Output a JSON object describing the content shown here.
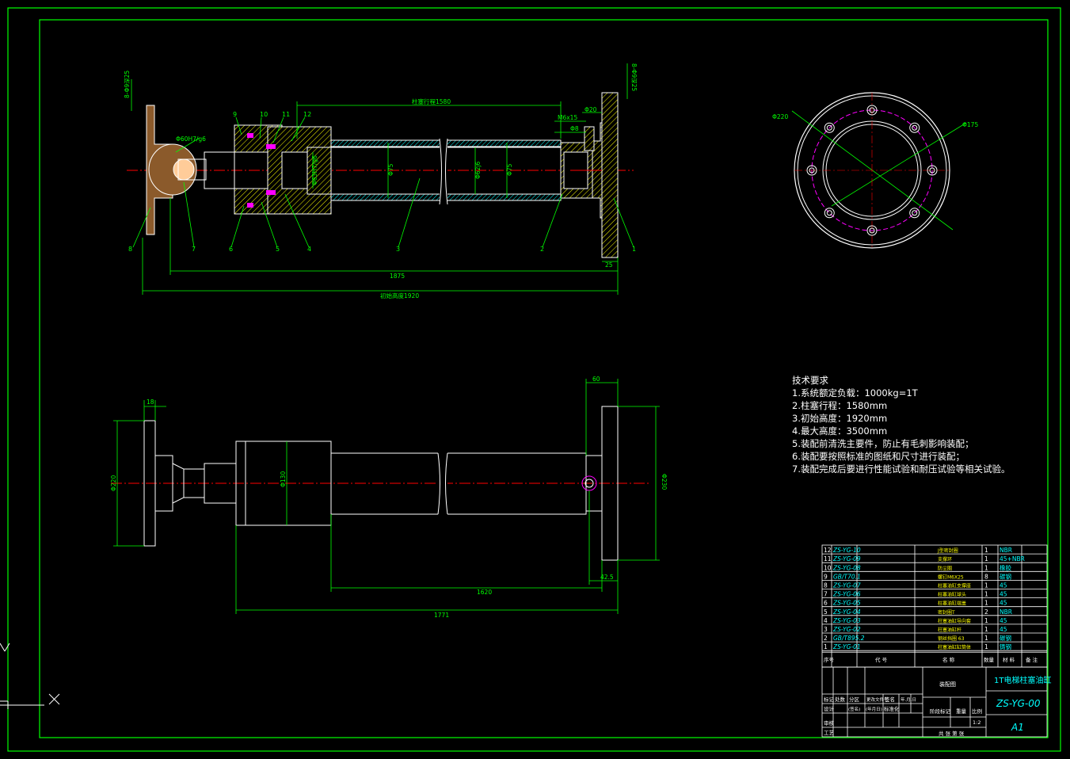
{
  "drawing": {
    "title": "1T电梯柱塞油缸",
    "drawing_number": "ZS-YG-00",
    "sheet_size": "A1",
    "scale": "1:2",
    "assembly_label": "装配图",
    "colors": {
      "background": "#000000",
      "frame": "#00ff00",
      "outline": "#ffffff",
      "centerline": "#ff0000",
      "hatch_yellow": "#ffff00",
      "dimension": "#00ff00",
      "section_cyan": "#00ffff",
      "seal": "#ff00ff",
      "flange_brown": "#8b5a2b",
      "magenta_circle": "#ff00ff"
    }
  },
  "technical_requirements": {
    "heading": "技术要求",
    "items": [
      "1.系统额定负载：1000kg=1T",
      "2.柱塞行程：1580mm",
      "3.初始高度：1920mm",
      "4.最大高度：3500mm",
      "5.装配前清洗主要件，防止有毛刺影响装配；",
      "6.装配要按照标准的图纸和尺寸进行装配；",
      "7.装配完成后要进行性能试验和耐压试验等相关试验。"
    ]
  },
  "section_view": {
    "dimensions": {
      "stroke": "柱塞行程1580",
      "overall": "初始高度1920",
      "length_1875": "1875",
      "d220": "Φ220",
      "d175": "Φ175",
      "d60h7g6": "Φ60H7/g6",
      "d63h7g6": "Φ63H7/g6",
      "d75": "Φ75",
      "d62j6": "Φ62j6",
      "d75b": "Φ75",
      "m6x15": "M6x15",
      "phi20": "Φ20",
      "phi8": "Φ8",
      "w25": "25",
      "holes_left": "8-Φ9深25",
      "holes_right": "8-Φ9深25"
    },
    "balloons": [
      "9",
      "10",
      "11",
      "12",
      "8",
      "7",
      "6",
      "5",
      "4",
      "3",
      "2",
      "1"
    ]
  },
  "side_view": {
    "dimensions": {
      "w18": "18",
      "h220": "Φ220",
      "d130": "Φ130",
      "w60": "60",
      "d230": "Φ230",
      "l1620": "1620",
      "l1771": "1771",
      "w42": "42.5"
    }
  },
  "bom": {
    "headers": {
      "no": "序号",
      "code": "代 号",
      "name": "名 称",
      "qty": "数量",
      "material": "材 料",
      "remark": "备 注"
    },
    "rows": [
      {
        "no": "12",
        "code": "ZS-YG-10",
        "name": "J型密封圈",
        "qty": "1",
        "material": "NBR"
      },
      {
        "no": "11",
        "code": "ZS-YG-09",
        "name": "支撑环",
        "qty": "1",
        "material": "45+NBR"
      },
      {
        "no": "10",
        "code": "ZS-YG-08",
        "name": "防尘圈",
        "qty": "1",
        "material": "橡胶"
      },
      {
        "no": "9",
        "code": "GB/T70.1",
        "name": "螺钉M6X25",
        "qty": "8",
        "material": "碳钢"
      },
      {
        "no": "8",
        "code": "ZS-YG-07",
        "name": "柱塞油缸支撑座",
        "qty": "1",
        "material": "45"
      },
      {
        "no": "7",
        "code": "ZS-YG-06",
        "name": "柱塞油缸球头",
        "qty": "1",
        "material": "45"
      },
      {
        "no": "6",
        "code": "ZS-YG-05",
        "name": "柱塞油缸端盖",
        "qty": "1",
        "material": "45"
      },
      {
        "no": "5",
        "code": "ZS-YG-04",
        "name": "密封圈T",
        "qty": "2",
        "material": "NBR"
      },
      {
        "no": "4",
        "code": "ZS-YG-03",
        "name": "柱塞油缸导向套",
        "qty": "1",
        "material": "45"
      },
      {
        "no": "3",
        "code": "ZS-YG-02",
        "name": "柱塞油缸杆",
        "qty": "1",
        "material": "45"
      },
      {
        "no": "2",
        "code": "GB/T895.2",
        "name": "钢丝挡圈 63",
        "qty": "1",
        "material": "碳钢"
      },
      {
        "no": "1",
        "code": "ZS-YG-01",
        "name": "柱塞油缸缸筒体",
        "qty": "1",
        "material": "铸钢"
      }
    ]
  },
  "title_block": {
    "labels": {
      "mark": "标记",
      "count": "处数",
      "zone": "分区",
      "change_doc": "更改文件号",
      "sign": "签名",
      "date": "年.月.日",
      "design": "设计",
      "sign2": "(签名)",
      "date2": "(年月日)",
      "std": "标准化",
      "sign3": "(签名)",
      "date3": "(年月日)",
      "stage": "阶段标记",
      "weight": "重量",
      "scale_label": "比例",
      "review": "审核",
      "process": "工艺",
      "sheets": "共  张 第  张"
    }
  },
  "ucs": {
    "y": "Y",
    "x": "X"
  }
}
